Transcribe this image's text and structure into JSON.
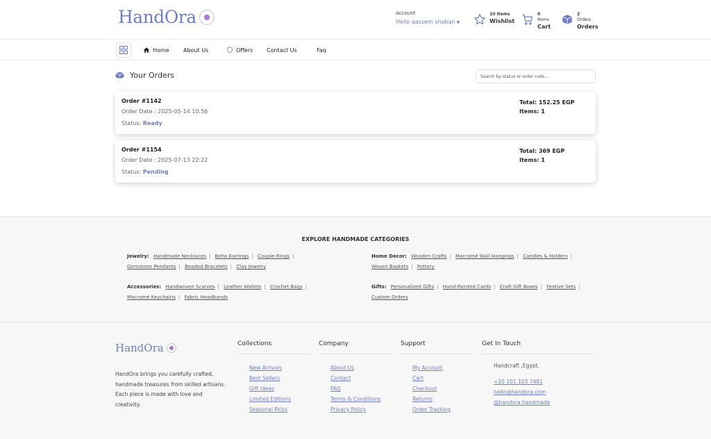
{
  "brand": {
    "name": "HandOra",
    "accent": "#6f7cc6"
  },
  "header": {
    "account_label": "Account",
    "account_name": "Hello qassem shaban",
    "wishlist": {
      "count": "10 Items",
      "label": "Wishlist",
      "icon": "star-icon"
    },
    "cart": {
      "count": "0",
      "sub": "Items",
      "label": "Cart",
      "icon": "cart-icon"
    },
    "orders": {
      "count": "2",
      "sub": "Orders",
      "label": "Orders",
      "icon": "box-icon"
    }
  },
  "nav": {
    "items": [
      {
        "label": "Home",
        "icon": "home-icon"
      },
      {
        "label": "About Us"
      },
      {
        "label": "Offers",
        "icon": "shield-icon"
      },
      {
        "label": "Contact Us"
      },
      {
        "label": "Faq"
      }
    ]
  },
  "orders_section": {
    "title": "Your Orders",
    "search_placeholder": "Search by status or order code...",
    "orders": [
      {
        "number": "Order #1142",
        "date": "Order Date : 2025-05-14 10:56",
        "status_label": "Status:",
        "status": "Ready",
        "total": "Total: 152.25 EGP",
        "items": "Items: 1"
      },
      {
        "number": "Order #1154",
        "date": "Order Date : 2025-07-13 22:22",
        "status_label": "Status:",
        "status": "Pending",
        "total": "Total: 369 EGP",
        "items": "Items: 1"
      }
    ]
  },
  "categories": {
    "title": "EXPLORE HANDMADE CATEGORIES",
    "groups": [
      {
        "name": "Jewelry:",
        "links": [
          "Handmade Necklaces",
          "Boho Earrings",
          "Couple Rings",
          "Gemstone Pendants",
          "Beaded Bracelets",
          "Clay Jewelry"
        ]
      },
      {
        "name": "Home Decor:",
        "links": [
          "Wooden Crafts",
          "Macramé Wall Hangings",
          "Candles & Holders",
          "Woven Baskets",
          "Pottery"
        ]
      },
      {
        "name": "Accessories:",
        "links": [
          "Handwoven Scarves",
          "Leather Wallets",
          "Crochet Bags",
          "Macramé Keychains",
          "Fabric Headbands"
        ]
      },
      {
        "name": "Gifts:",
        "links": [
          "Personalized Gifts",
          "Hand-Painted Cards",
          "Craft Gift Boxes",
          "Festive Sets",
          "Custom Orders"
        ]
      }
    ]
  },
  "footer": {
    "description": "HandOra brings you carefully crafted, handmade treasures from skilled artisans. Each piece is made with love and creativity.",
    "columns": [
      {
        "title": "Collections",
        "links": [
          "New Arrivals",
          "Best Sellers",
          "Gift Ideas",
          "Limited Editions",
          "Seasonal Picks"
        ]
      },
      {
        "title": "Company",
        "links": [
          "About Us",
          "Contact",
          "FAQ",
          "Terms & Conditions",
          "Privacy Policy"
        ]
      },
      {
        "title": "Support",
        "links": [
          "My Account",
          "Cart",
          "Checkout",
          "Returns",
          "Order Tracking"
        ]
      }
    ],
    "contact": {
      "title": "Get In Touch",
      "location": "Handcraft ,Egypt.",
      "phone": "+20 101 103 7481",
      "email": "hello@handora.com",
      "social": "@handora.handmade"
    }
  }
}
